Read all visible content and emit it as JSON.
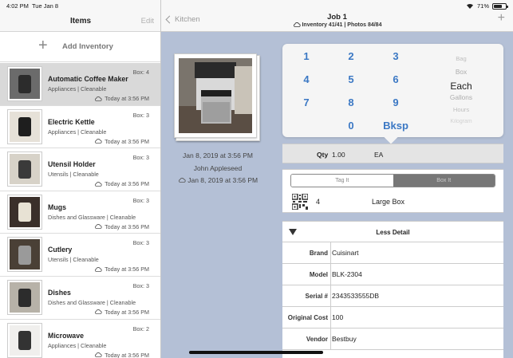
{
  "status": {
    "time": "4:02 PM",
    "date": "Tue Jan 8",
    "battery": "71%",
    "battery_level": 0.71
  },
  "sidebar": {
    "title": "Items",
    "edit_label": "Edit",
    "add_label": "Add Inventory",
    "items": [
      {
        "name": "Automatic Coffee Maker",
        "category": "Appliances | Cleanable",
        "box": "Box: 4",
        "date": "Today at 3:56 PM",
        "selected": true
      },
      {
        "name": "Electric Kettle",
        "category": "Appliances | Cleanable",
        "box": "Box: 3",
        "date": "Today at 3:56 PM"
      },
      {
        "name": "Utensil Holder",
        "category": "Utensils | Cleanable",
        "box": "Box: 3",
        "date": "Today at 3:56 PM"
      },
      {
        "name": "Mugs",
        "category": "Dishes and Glassware | Cleanable",
        "box": "Box: 3",
        "date": "Today at 3:56 PM"
      },
      {
        "name": "Cutlery",
        "category": "Utensils | Cleanable",
        "box": "Box: 3",
        "date": "Today at 3:56 PM"
      },
      {
        "name": "Dishes",
        "category": "Dishes and Glassware | Cleanable",
        "box": "Box: 3",
        "date": "Today at 3:56 PM"
      },
      {
        "name": "Microwave",
        "category": "Appliances | Cleanable",
        "box": "Box: 2",
        "date": "Today at 3:56 PM"
      }
    ]
  },
  "main": {
    "back_label": "Kitchen",
    "title": "Job 1",
    "subtitle": "Inventory 41/41 | Photos 84/84",
    "photo_meta": {
      "created": "Jan 8, 2019 at 3:56 PM",
      "author": "John Appleseed",
      "synced": "Jan 8, 2019 at 3:56 PM"
    },
    "keypad": {
      "keys": [
        "1",
        "2",
        "3",
        "4",
        "5",
        "6",
        "7",
        "8",
        "9",
        "0",
        "Bksp"
      ],
      "units": [
        "Bag",
        "Box",
        "Each",
        "Gallons",
        "Hours",
        "Kilogram"
      ],
      "selected_unit": "Each"
    },
    "qty": {
      "label": "Qty",
      "value": "1.00",
      "unit": "EA"
    },
    "segment": {
      "tag_label": "Tag It",
      "box_label": "Box It"
    },
    "box": {
      "number": "4",
      "name": "Large Box"
    },
    "details": {
      "toggle_label": "Less Detail",
      "rows": [
        {
          "label": "Brand",
          "value": "Cuisinart"
        },
        {
          "label": "Model",
          "value": "BLK-2304"
        },
        {
          "label": "Serial #",
          "value": "2343533555DB"
        },
        {
          "label": "Original Cost",
          "value": "100"
        },
        {
          "label": "Vendor",
          "value": "Bestbuy"
        }
      ]
    }
  }
}
